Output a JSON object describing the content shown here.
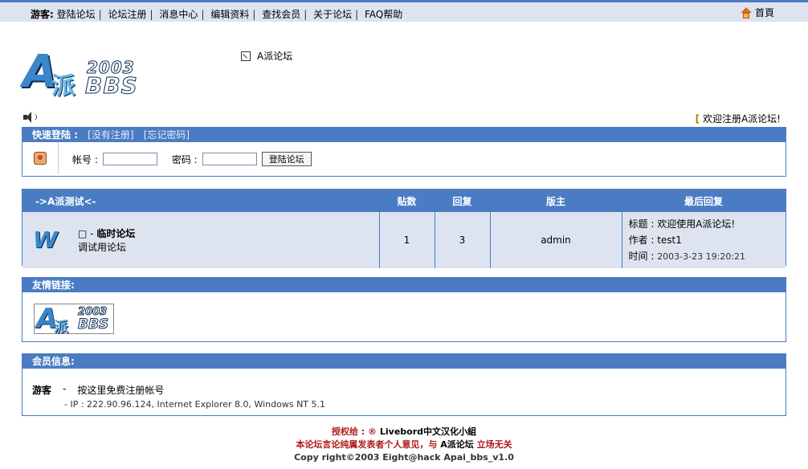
{
  "topnav": {
    "guest_label": "游客:",
    "items": [
      "登陆论坛",
      "论坛注册",
      "消息中心",
      "编辑资料",
      "查找会员",
      "关于论坛",
      "FAQ帮助"
    ],
    "home_label": "首頁"
  },
  "logo": {
    "a": "A",
    "pai": "派",
    "year": "2003",
    "bbs": "BBS"
  },
  "forum_link": "A派论坛",
  "welcome": {
    "bracket": "[",
    "text": "欢迎注册A派论坛!"
  },
  "login": {
    "title": "快速登陆 :",
    "register": "[没有注册]",
    "forgot": "[忘记密码]",
    "account_label": "帐号 :",
    "password_label": "密码 :",
    "account_value": "",
    "password_value": "",
    "submit": "登陆论坛"
  },
  "forum": {
    "headers": {
      "name": "->A派测试<-",
      "posts": "贴数",
      "replies": "回复",
      "moderator": "版主",
      "last": "最后回复"
    },
    "row": {
      "icon_letter": "W",
      "title_prefix": "□ -",
      "title": "临时论坛",
      "desc": "调试用论坛",
      "posts": "1",
      "replies": "3",
      "moderator": "admin",
      "last_title_label": "标题 :",
      "last_title": "欢迎使用A派论坛!",
      "last_author_label": "作者 :",
      "last_author": "test1",
      "last_time_label": "时间 :",
      "last_time": "2003-3-23 19:20:21"
    }
  },
  "links": {
    "title": "友情链接:"
  },
  "members": {
    "title": "会员信息:",
    "guest_label": "游客",
    "dash1": "-",
    "line1": "按这里免费注册帐号",
    "line2": "- IP : 222.90.96.124, Internet Explorer 8.0, Windows NT 5.1"
  },
  "footer": {
    "line1_prefix": "授权给 : ®",
    "line1_name": "Livebord中文汉化小組",
    "line2_a": "本论坛言论纯属发表者个人意见，与",
    "line2_name": "A派论坛",
    "line2_b": "立场无关",
    "line3": "Copy right©2003 Eight@hack Apai_bbs_v1.0"
  },
  "colors": {
    "accent": "#4a7cc4",
    "row_bg": "#dde4ef",
    "footer_red": "#b01818"
  }
}
